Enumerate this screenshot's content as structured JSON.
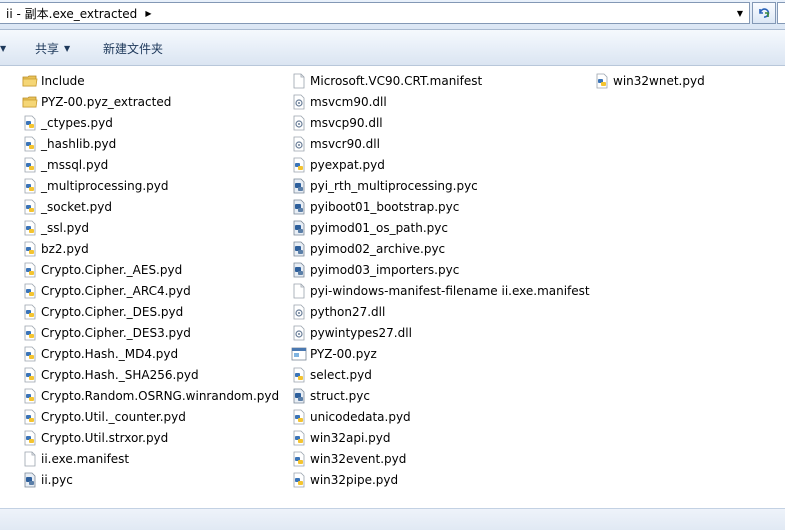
{
  "address": {
    "path": "ii - 副本.exe_extracted",
    "breadcrumb_arrow": "▶",
    "dropdown_arrow": "▼",
    "refresh_icon": "refresh-icon"
  },
  "toolbar": {
    "left_arrow": "▼",
    "share_label": "共享",
    "share_caret": "▼",
    "new_folder_label": "新建文件夹"
  },
  "files": {
    "column1": [
      {
        "name": "Include",
        "icon": "folder-icon"
      },
      {
        "name": "PYZ-00.pyz_extracted",
        "icon": "folder-icon"
      },
      {
        "name": "_ctypes.pyd",
        "icon": "python-file-icon"
      },
      {
        "name": "_hashlib.pyd",
        "icon": "python-file-icon"
      },
      {
        "name": "_mssql.pyd",
        "icon": "python-file-icon"
      },
      {
        "name": "_multiprocessing.pyd",
        "icon": "python-file-icon"
      },
      {
        "name": "_socket.pyd",
        "icon": "python-file-icon"
      },
      {
        "name": "_ssl.pyd",
        "icon": "python-file-icon"
      },
      {
        "name": "bz2.pyd",
        "icon": "python-file-icon"
      },
      {
        "name": "Crypto.Cipher._AES.pyd",
        "icon": "python-file-icon"
      },
      {
        "name": "Crypto.Cipher._ARC4.pyd",
        "icon": "python-file-icon"
      },
      {
        "name": "Crypto.Cipher._DES.pyd",
        "icon": "python-file-icon"
      },
      {
        "name": "Crypto.Cipher._DES3.pyd",
        "icon": "python-file-icon"
      },
      {
        "name": "Crypto.Hash._MD4.pyd",
        "icon": "python-file-icon"
      },
      {
        "name": "Crypto.Hash._SHA256.pyd",
        "icon": "python-file-icon"
      },
      {
        "name": "Crypto.Random.OSRNG.winrandom.pyd",
        "icon": "python-file-icon"
      },
      {
        "name": "Crypto.Util._counter.pyd",
        "icon": "python-file-icon"
      },
      {
        "name": "Crypto.Util.strxor.pyd",
        "icon": "python-file-icon"
      },
      {
        "name": "ii.exe.manifest",
        "icon": "blank-file-icon"
      },
      {
        "name": "ii.pyc",
        "icon": "python-compiled-icon"
      }
    ],
    "column2": [
      {
        "name": "Microsoft.VC90.CRT.manifest",
        "icon": "blank-file-icon"
      },
      {
        "name": "msvcm90.dll",
        "icon": "dll-file-icon"
      },
      {
        "name": "msvcp90.dll",
        "icon": "dll-file-icon"
      },
      {
        "name": "msvcr90.dll",
        "icon": "dll-file-icon"
      },
      {
        "name": "pyexpat.pyd",
        "icon": "python-file-icon"
      },
      {
        "name": "pyi_rth_multiprocessing.pyc",
        "icon": "python-compiled-icon"
      },
      {
        "name": "pyiboot01_bootstrap.pyc",
        "icon": "python-compiled-icon"
      },
      {
        "name": "pyimod01_os_path.pyc",
        "icon": "python-compiled-icon"
      },
      {
        "name": "pyimod02_archive.pyc",
        "icon": "python-compiled-icon"
      },
      {
        "name": "pyimod03_importers.pyc",
        "icon": "python-compiled-icon"
      },
      {
        "name": "pyi-windows-manifest-filename ii.exe.manifest",
        "icon": "blank-file-icon"
      },
      {
        "name": "python27.dll",
        "icon": "dll-file-icon"
      },
      {
        "name": "pywintypes27.dll",
        "icon": "dll-file-icon"
      },
      {
        "name": "PYZ-00.pyz",
        "icon": "pyz-file-icon"
      },
      {
        "name": "select.pyd",
        "icon": "python-file-icon"
      },
      {
        "name": "struct.pyc",
        "icon": "python-compiled-icon"
      },
      {
        "name": "unicodedata.pyd",
        "icon": "python-file-icon"
      },
      {
        "name": "win32api.pyd",
        "icon": "python-file-icon"
      },
      {
        "name": "win32event.pyd",
        "icon": "python-file-icon"
      },
      {
        "name": "win32pipe.pyd",
        "icon": "python-file-icon"
      }
    ],
    "column3": [
      {
        "name": "win32wnet.pyd",
        "icon": "python-file-icon"
      }
    ]
  }
}
